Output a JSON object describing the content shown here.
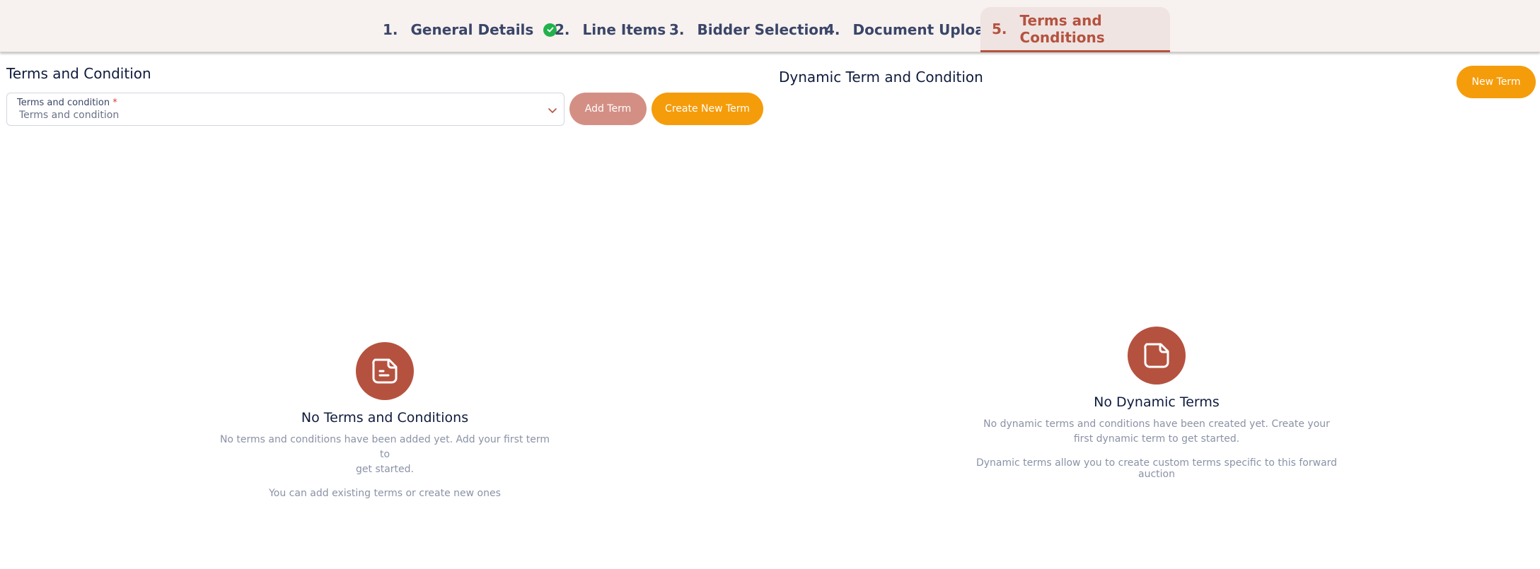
{
  "stepper": {
    "steps": [
      {
        "num": "1.",
        "label": "General Details",
        "completed": true
      },
      {
        "num": "2.",
        "label": "Line Items"
      },
      {
        "num": "3.",
        "label": "Bidder Selection"
      },
      {
        "num": "4.",
        "label": "Document Upload"
      },
      {
        "num": "5.",
        "label": "Terms and Conditions",
        "active": true
      }
    ]
  },
  "left": {
    "title": "Terms and Condition",
    "select": {
      "label": "Terms and condition",
      "required_mark": "*",
      "placeholder": "Terms and condition"
    },
    "add_button": "Add Term",
    "create_button": "Create New Term",
    "empty": {
      "title": "No Terms and Conditions",
      "desc_line1": "No terms and conditions have been added yet. Add your first term to",
      "desc_line2": "get started.",
      "hint": "You can add existing terms or create new ones"
    }
  },
  "right": {
    "title": "Dynamic Term and Condition",
    "new_button": "New Term",
    "empty": {
      "title": "No Dynamic Terms",
      "desc_line1": "No dynamic terms and conditions have been created yet. Create your",
      "desc_line2": "first dynamic term to get started.",
      "hint": "Dynamic terms allow you to create custom terms specific to this forward auction"
    }
  },
  "colors": {
    "accent": "#b5523f",
    "orange": "#f59c0b",
    "success": "#22b14c"
  },
  "icons": {
    "completed_step": "check-circle-icon",
    "select_chevron": "chevron-down-icon",
    "left_empty": "sticky-note-lines-icon",
    "right_empty": "sticky-note-icon"
  }
}
